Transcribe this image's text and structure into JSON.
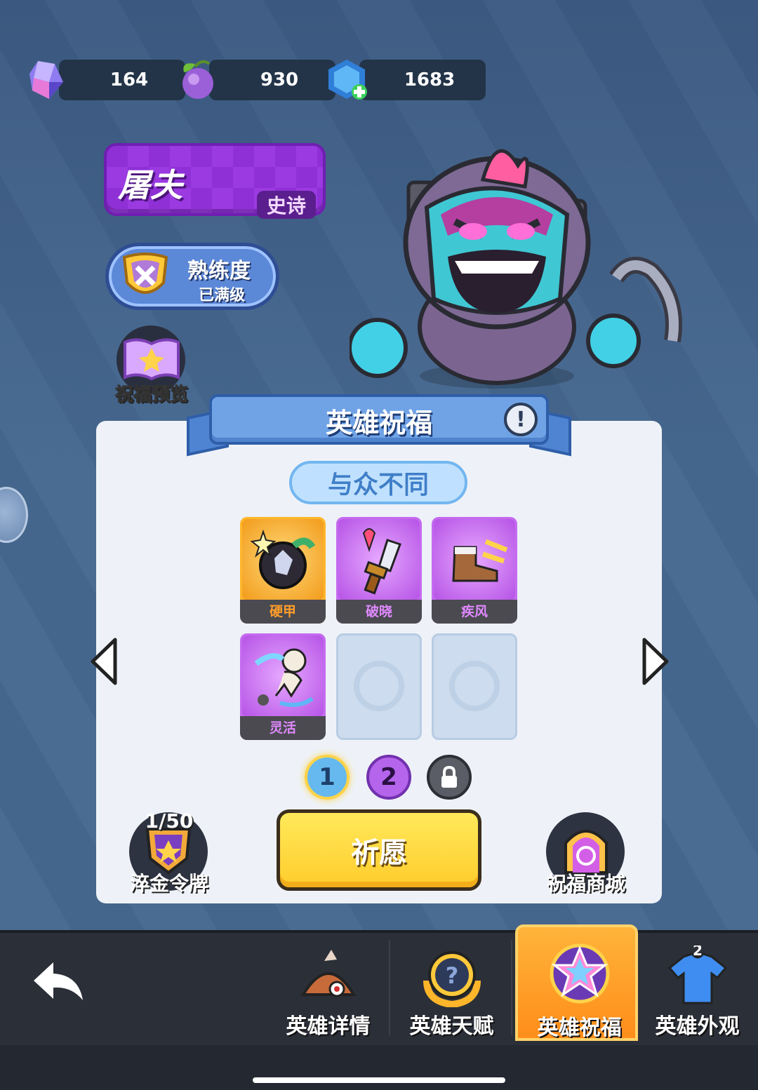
{
  "currencies": [
    {
      "name": "crystal-icon",
      "value": "164"
    },
    {
      "name": "fruit-icon",
      "value": "930"
    },
    {
      "name": "blue-gem-icon",
      "value": "1683"
    }
  ],
  "hero": {
    "name": "屠夫",
    "rarity": "史诗",
    "mastery_title": "熟练度",
    "mastery_status": "已满级"
  },
  "blessing_preview_label": "祝福预览",
  "panel": {
    "title": "英雄祝福",
    "info_symbol": "!",
    "subtitle": "与众不同",
    "cards": [
      {
        "name": "硬甲",
        "rarity": "gold",
        "icon": "bomb-icon"
      },
      {
        "name": "破晓",
        "rarity": "purple",
        "icon": "dagger-icon"
      },
      {
        "name": "疾风",
        "rarity": "purple",
        "icon": "boot-icon"
      },
      {
        "name": "灵活",
        "rarity": "purple",
        "icon": "dodge-icon"
      },
      {
        "name": "",
        "rarity": "empty",
        "icon": "empty-slot-icon"
      },
      {
        "name": "",
        "rarity": "empty",
        "icon": "empty-slot-icon"
      }
    ],
    "pages": [
      "1",
      "2"
    ],
    "pray_label": "祈愿",
    "token_count": "1/50",
    "token_label": "淬金令牌",
    "shop_label": "祝福商城"
  },
  "nav": {
    "tabs": [
      {
        "label": "英雄详情",
        "icon": "hero-detail-icon"
      },
      {
        "label": "英雄天赋",
        "icon": "talent-icon"
      },
      {
        "label": "英雄祝福",
        "icon": "blessing-star-icon",
        "active": true
      },
      {
        "label": "英雄外观",
        "icon": "shirt-icon",
        "badge": "2"
      }
    ]
  },
  "colors": {
    "epic_purple": "#9a3ae0",
    "accent_orange": "#ff9d1a",
    "pray_yellow": "#ffd23a",
    "panel_bg": "#eef2f8"
  }
}
